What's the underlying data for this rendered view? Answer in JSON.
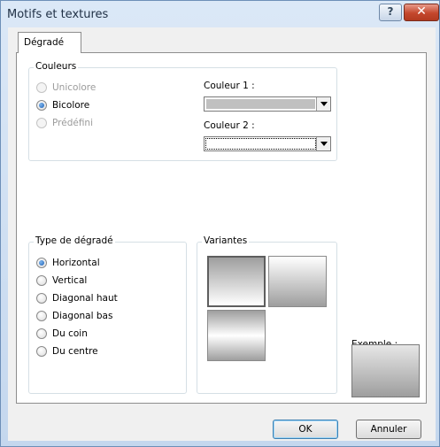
{
  "window": {
    "title": "Motifs et textures",
    "help_label": "?",
    "close_label": "✕"
  },
  "tabs": [
    {
      "label": "Dégradé",
      "selected": true
    }
  ],
  "couleurs": {
    "legend": "Couleurs",
    "options": [
      {
        "label": "Unicolore",
        "checked": false,
        "enabled": false
      },
      {
        "label": "Bicolore",
        "checked": true,
        "enabled": true
      },
      {
        "label": "Prédéfini",
        "checked": false,
        "enabled": false
      }
    ],
    "couleur1_label": "Couleur 1 :",
    "couleur1_value_color": "#c0c0c0",
    "couleur2_label": "Couleur 2 :",
    "couleur2_value_color": "#ffffff"
  },
  "type_degrade": {
    "legend": "Type de dégradé",
    "options": [
      {
        "label": "Horizontal",
        "checked": true
      },
      {
        "label": "Vertical",
        "checked": false
      },
      {
        "label": "Diagonal haut",
        "checked": false
      },
      {
        "label": "Diagonal bas",
        "checked": false
      },
      {
        "label": "Du coin",
        "checked": false
      },
      {
        "label": "Du centre",
        "checked": false
      }
    ]
  },
  "variantes": {
    "legend": "Variantes",
    "items": [
      {
        "name": "variant-light-to-dark",
        "selected": true
      },
      {
        "name": "variant-dark-to-light",
        "selected": false
      },
      {
        "name": "variant-center-out",
        "selected": false
      }
    ]
  },
  "exemple": {
    "label": "Exemple :"
  },
  "buttons": {
    "ok": "OK",
    "cancel": "Annuler"
  },
  "colors": {
    "gradient_dark": "#9e9e9e",
    "gradient_light": "#ffffff",
    "accent": "#1b5fb4"
  }
}
